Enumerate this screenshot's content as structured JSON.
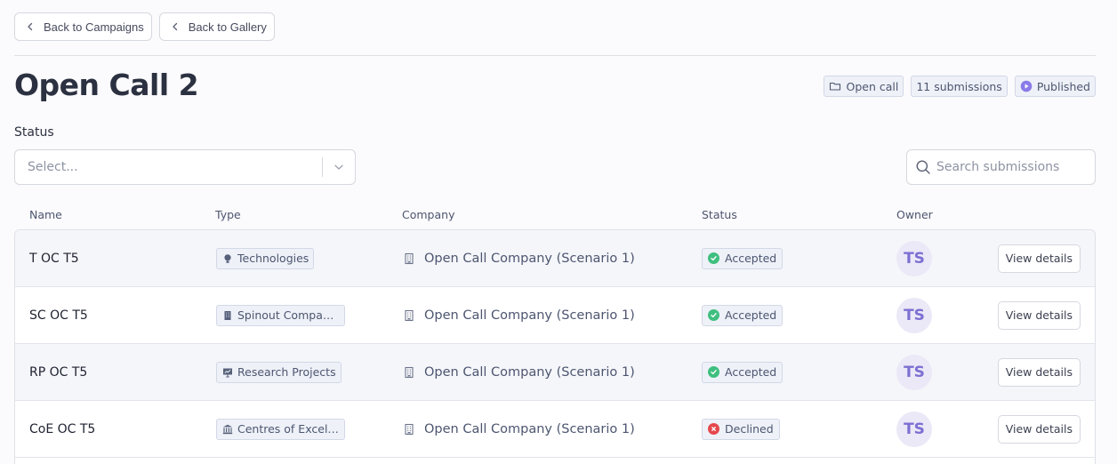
{
  "nav": {
    "back_campaigns": "Back to Campaigns",
    "back_gallery": "Back to Gallery"
  },
  "page": {
    "title": "Open Call 2",
    "meta": {
      "type": "Open call",
      "submissions": "11 submissions",
      "state": "Published"
    }
  },
  "filters": {
    "status_label": "Status",
    "status_placeholder": "Select...",
    "search_placeholder": "Search submissions"
  },
  "table": {
    "headers": {
      "name": "Name",
      "type": "Type",
      "company": "Company",
      "status": "Status",
      "owner": "Owner"
    },
    "rows": [
      {
        "name": "T OC T5",
        "type": "Technologies",
        "type_icon": "bulb-icon",
        "company": "Open Call Company (Scenario 1)",
        "status": "Accepted",
        "owner": "TS",
        "action": "View details"
      },
      {
        "name": "SC OC T5",
        "type": "Spinout Companies",
        "type_icon": "building-icon",
        "company": "Open Call Company (Scenario 1)",
        "status": "Accepted",
        "owner": "TS",
        "action": "View details"
      },
      {
        "name": "RP OC T5",
        "type": "Research Projects",
        "type_icon": "presentation-icon",
        "company": "Open Call Company (Scenario 1)",
        "status": "Accepted",
        "owner": "TS",
        "action": "View details"
      },
      {
        "name": "CoE OC T5",
        "type": "Centres of Excellence",
        "type_icon": "institution-icon",
        "company": "Open Call Company (Scenario 1)",
        "status": "Declined",
        "owner": "TS",
        "action": "View details"
      }
    ]
  },
  "colors": {
    "accepted": "#3fbf7f",
    "declined": "#e5484d",
    "owner_accent": "#7c6fd3",
    "published_accent": "#8b7be8"
  }
}
